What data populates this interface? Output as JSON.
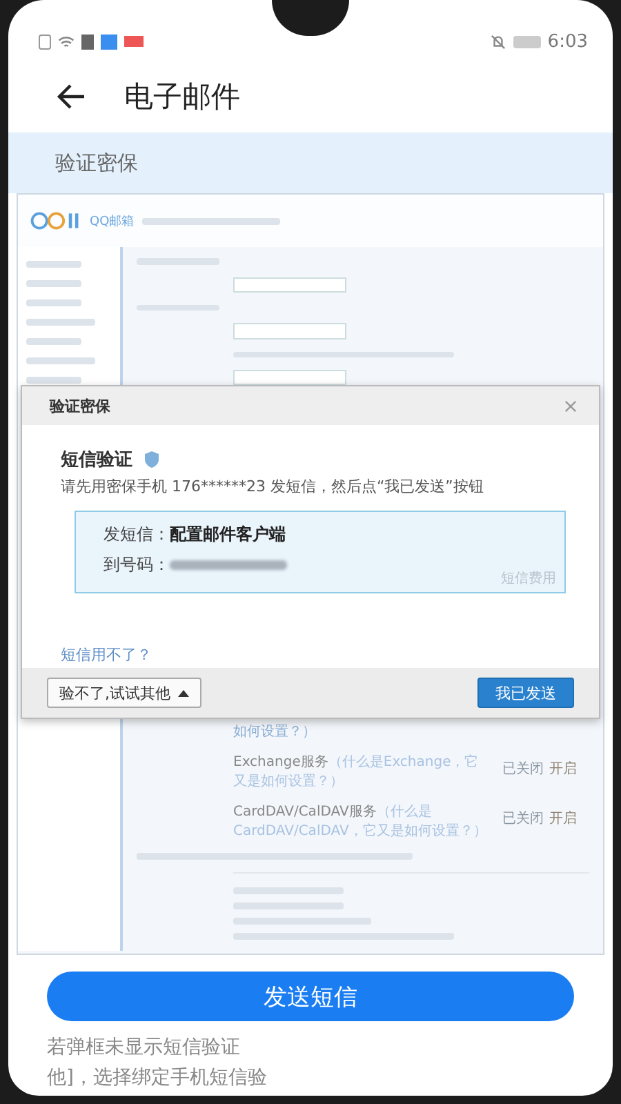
{
  "status_bar": {
    "time": "6:03"
  },
  "header": {
    "title": "电子邮件"
  },
  "section": {
    "title": "验证密保"
  },
  "screenshot": {
    "logo_text": "QQ邮箱",
    "cut_line": "如何设置？）",
    "services": [
      {
        "name": "Exchange服务",
        "note": "（什么是Exchange，它又是如何设置？）",
        "status": "已关闭",
        "action": "开启"
      },
      {
        "name": "CardDAV/CalDAV服务",
        "note": "（什么是CardDAV/CalDAV，它又是如何设置？）",
        "status": "已关闭",
        "action": "开启"
      }
    ]
  },
  "dialog": {
    "title": "验证密保",
    "heading": "短信验证",
    "instruction": "请先用密保手机 176******23 发短信，然后点“我已发送”按钮",
    "sms_label": "发短信：",
    "sms_content": "配置邮件客户端",
    "number_label": "到号码：",
    "fee_link": "短信费用",
    "help_link": "短信用不了？",
    "alt_button": "验不了,试试其他",
    "confirm_button": "我已发送"
  },
  "send_button": "发送短信",
  "footer_lines": [
    "若弹框未显示短信验证",
    "他]，选择绑定手机短信验"
  ]
}
